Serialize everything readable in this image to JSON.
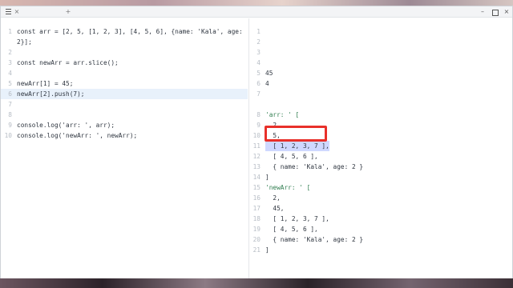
{
  "window": {
    "tab_close_glyph": "×",
    "tab_add_glyph": "+",
    "minimize_glyph": "–",
    "close_glyph": "×"
  },
  "editor": {
    "lines": [
      {
        "n": "1",
        "text": "const arr = [2, 5, [1, 2, 3], [4, 5, 6], {name: 'Kala', age:"
      },
      {
        "n": "",
        "text": "2}];"
      },
      {
        "n": "2",
        "text": ""
      },
      {
        "n": "3",
        "text": "const newArr = arr.slice();"
      },
      {
        "n": "4",
        "text": ""
      },
      {
        "n": "5",
        "text": "newArr[1] = 45;"
      },
      {
        "n": "6",
        "text": "newArr[2].push(7);"
      },
      {
        "n": "7",
        "text": ""
      },
      {
        "n": "8",
        "text": ""
      },
      {
        "n": "9",
        "text": "console.log('arr: ', arr);"
      },
      {
        "n": "10",
        "text": "console.log('newArr: ', newArr);"
      }
    ]
  },
  "output": {
    "lines": [
      {
        "n": "1",
        "text": ""
      },
      {
        "n": "2",
        "text": ""
      },
      {
        "n": "3",
        "text": ""
      },
      {
        "n": "4",
        "text": ""
      },
      {
        "n": "5",
        "text": "45"
      },
      {
        "n": "6",
        "text": "4"
      },
      {
        "n": "7",
        "text": ""
      },
      {
        "n": "8",
        "text": "'arr: ' ["
      },
      {
        "n": "9",
        "text": "  2,"
      },
      {
        "n": "10",
        "text": "  5,"
      },
      {
        "n": "11",
        "text": "  [ 1, 2, 3, 7 ],"
      },
      {
        "n": "12",
        "text": "  [ 4, 5, 6 ],"
      },
      {
        "n": "13",
        "text": "  { name: 'Kala', age: 2 }"
      },
      {
        "n": "14",
        "text": "]"
      },
      {
        "n": "15",
        "text": "'newArr: ' ["
      },
      {
        "n": "16",
        "text": "  2,"
      },
      {
        "n": "17",
        "text": "  45,"
      },
      {
        "n": "18",
        "text": "  [ 1, 2, 3, 7 ],"
      },
      {
        "n": "19",
        "text": "  [ 4, 5, 6 ],"
      },
      {
        "n": "20",
        "text": "  { name: 'Kala', age: 2 }"
      },
      {
        "n": "21",
        "text": "]"
      }
    ]
  },
  "colors": {
    "highlight_box": "#e8302a",
    "active_line": "#e8f1fb",
    "string": "#2f7d4f"
  }
}
